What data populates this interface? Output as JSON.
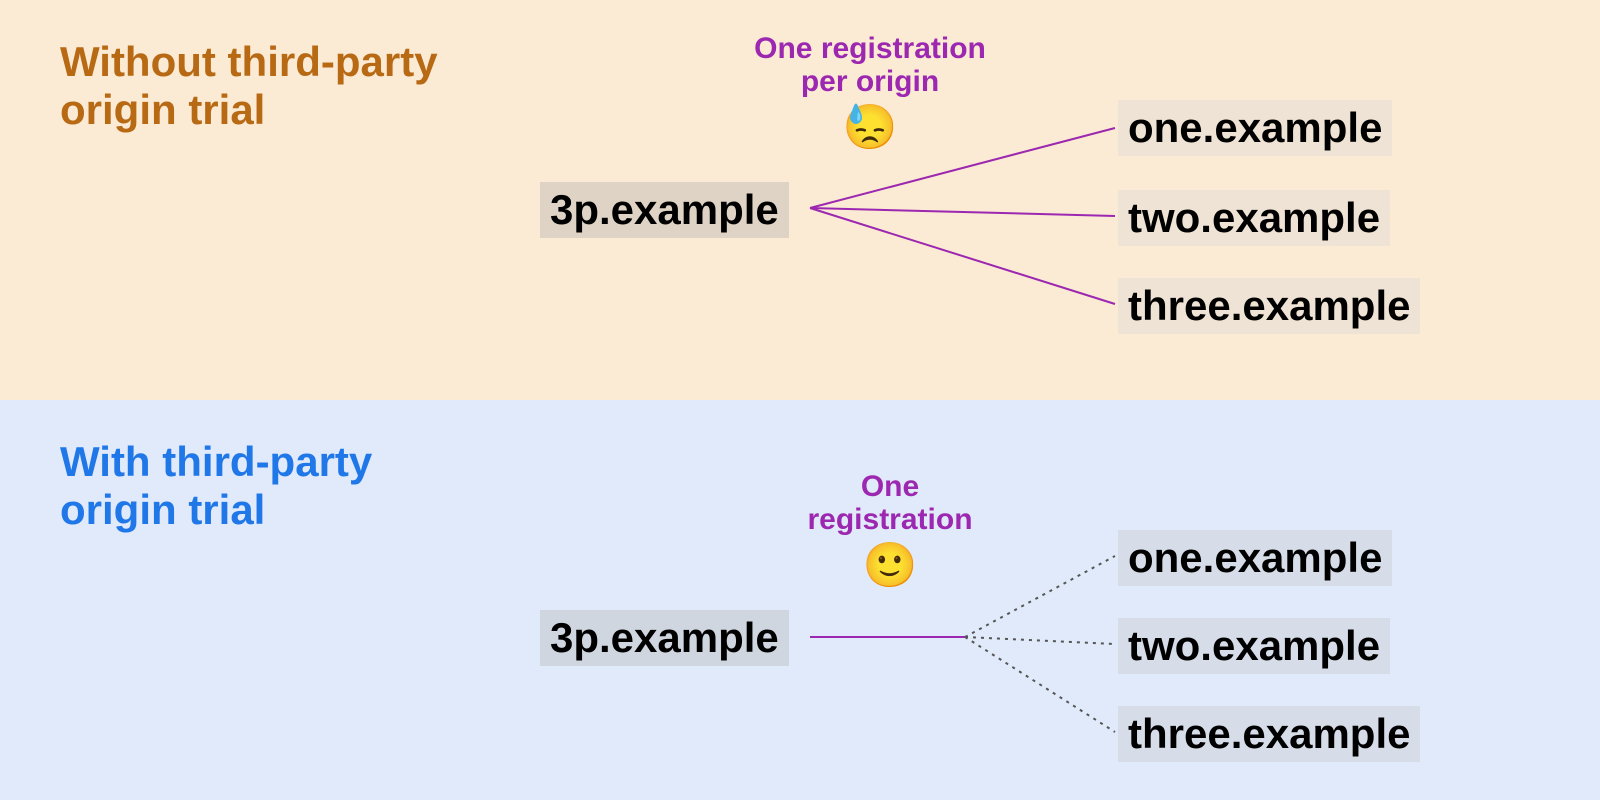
{
  "top": {
    "title": "Without third-party origin trial",
    "source": "3p.example",
    "annotation_line1": "One registration",
    "annotation_line2": "per origin",
    "emoji": "😓",
    "destinations": [
      "one.example",
      "two.example",
      "three.example"
    ]
  },
  "bottom": {
    "title": "With third-party origin trial",
    "source": "3p.example",
    "annotation_line1": "One",
    "annotation_line2": "registration",
    "emoji": "🙂",
    "destinations": [
      "one.example",
      "two.example",
      "three.example"
    ]
  },
  "colors": {
    "purple": "#9c27b0",
    "top_title": "#b86914",
    "bottom_title": "#1f77e8"
  }
}
